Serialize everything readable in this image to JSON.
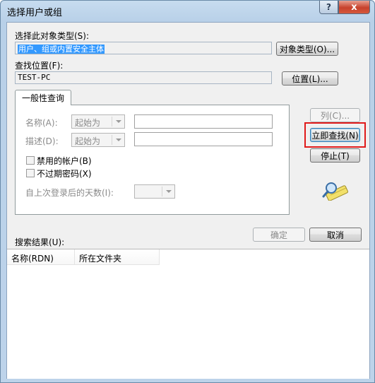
{
  "window": {
    "title": "选择用户或组"
  },
  "titlebar": {
    "help_glyph": "?",
    "close_glyph": "x"
  },
  "object_type": {
    "label": "选择此对象类型(S):",
    "value": "用户、组或内置安全主体",
    "button": "对象类型(O)..."
  },
  "location": {
    "label": "查找位置(F):",
    "value": "TEST-PC",
    "button": "位置(L)..."
  },
  "tab": {
    "label": "一般性查询"
  },
  "query": {
    "name_label": "名称(A):",
    "name_mode": "起始为",
    "desc_label": "描述(D):",
    "desc_mode": "起始为",
    "disabled_accounts": "禁用的帐户(B)",
    "non_expiring_pwd": "不过期密码(X)",
    "days_since_login_label": "自上次登录后的天数(I):"
  },
  "side_buttons": {
    "columns": "列(C)...",
    "find_now": "立即查找(N)",
    "stop": "停止(T)"
  },
  "dialog_buttons": {
    "ok": "确定",
    "cancel": "取消"
  },
  "results": {
    "label": "搜索结果(U):",
    "columns": [
      "名称(RDN)",
      "所在文件夹"
    ]
  },
  "colors": {
    "highlight": "#e01a1a",
    "selection": "#3399ff"
  }
}
